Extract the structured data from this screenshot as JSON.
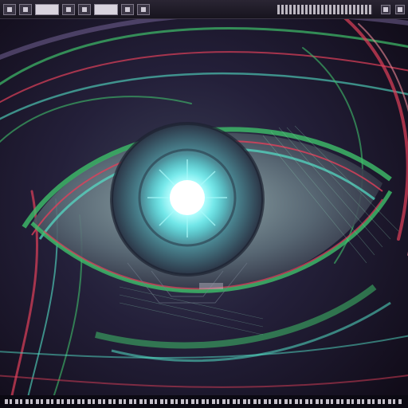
{
  "image": {
    "subject": "eye-artwork",
    "colors": {
      "background": "#120d1c",
      "iris_glow": "#9ff6ff",
      "cyan": "#54e0c7",
      "green": "#3fbf6a",
      "red": "#e0405a",
      "purple": "#7b6aa0"
    }
  },
  "toolbar": {
    "icons": [
      "toolbar-icon",
      "toolbar-icon",
      "toolbar-icon",
      "toolbar-icon",
      "toolbar-icon",
      "toolbar-icon",
      "toolbar-icon",
      "toolbar-icon"
    ]
  }
}
